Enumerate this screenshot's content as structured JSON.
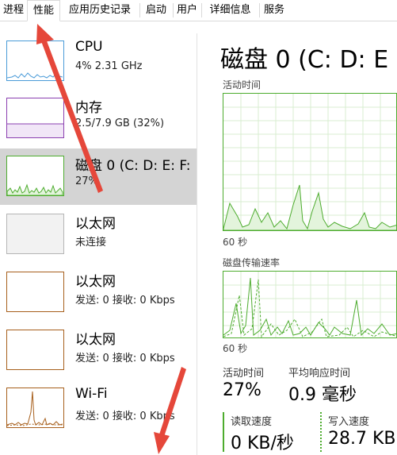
{
  "tabs": [
    "进程",
    "性能",
    "应用历史记录",
    "启动",
    "用户",
    "详细信息",
    "服务"
  ],
  "sidebar": {
    "items": [
      {
        "title": "CPU",
        "sub": "4% 2.31 GHz"
      },
      {
        "title": "内存",
        "sub": "2.5/7.9 GB (32%)"
      },
      {
        "title": "磁盘 0 (C: D: E: F:",
        "sub": "27%"
      },
      {
        "title": "以太网",
        "sub": "未连接"
      },
      {
        "title": "以太网",
        "sub": "发送: 0 接收: 0 Kbps"
      },
      {
        "title": "以太网",
        "sub": "发送: 0 接收: 0 Kbps"
      },
      {
        "title": "Wi-Fi",
        "sub": "发送: 0 接收: 0 Kbps"
      }
    ]
  },
  "detail": {
    "title": "磁盘 0 (C: D: E",
    "active_time_label": "活动时间",
    "seconds_label_1": "60 秒",
    "transfer_label": "磁盘传输速率",
    "seconds_label_2": "60 秒",
    "stats": {
      "active_time_label": "活动时间",
      "active_time_value": "27%",
      "avg_response_label": "平均响应时间",
      "avg_response_value": "0.9 毫秒",
      "read_label": "读取速度",
      "read_value": "0 KB/秒",
      "write_label": "写入速度",
      "write_value": "28.7 KB"
    }
  },
  "colors": {
    "cpu": "#4a9bd8",
    "memory": "#8b3fb0",
    "disk": "#4dac2e",
    "ethernet": "#a75f1c",
    "arrow": "#e5473a",
    "selected": "#d4d4d4"
  }
}
